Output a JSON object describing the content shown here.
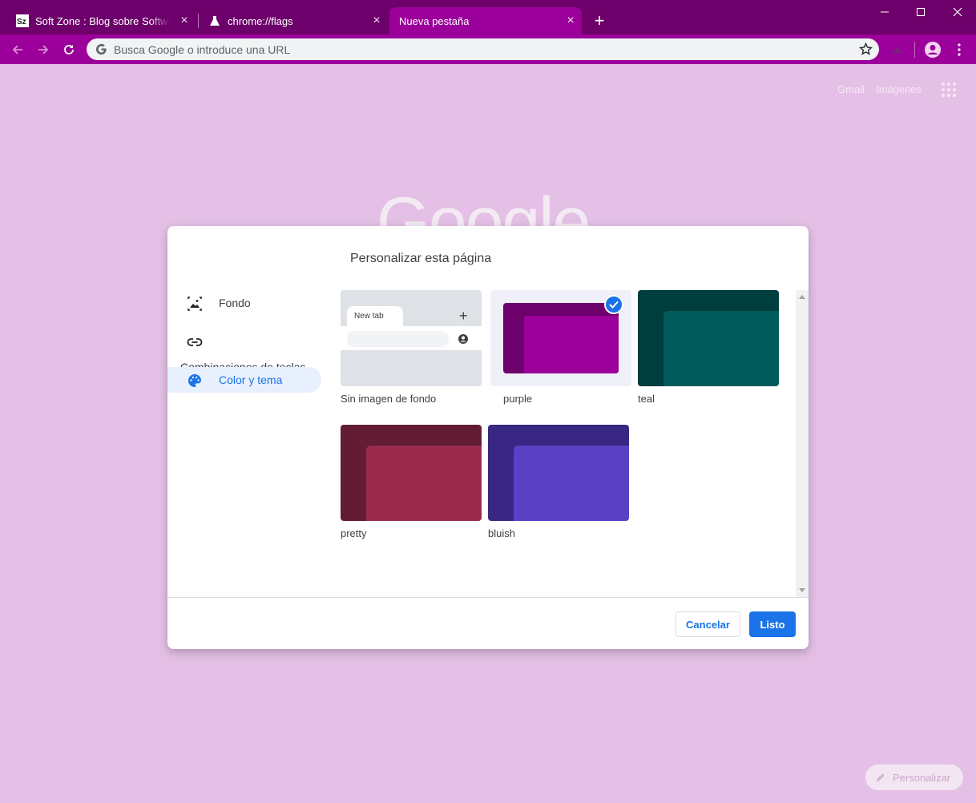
{
  "tabs": [
    {
      "title": "Soft Zone : Blog sobre Software d",
      "favicon": "softzone-icon"
    },
    {
      "title": "chrome://flags",
      "favicon": "flask-icon"
    },
    {
      "title": "Nueva pestaña",
      "favicon": "none",
      "active": true
    }
  ],
  "omnibox": {
    "placeholder": "Busca Google o introduce una URL"
  },
  "header": {
    "gmail": "Gmail",
    "images": "Imágenes"
  },
  "logo_text": "Google",
  "dialog": {
    "title": "Personalizar esta página",
    "menu": {
      "background": "Fondo",
      "shortcuts": "Combinaciones de teclas",
      "color_theme": "Color y tema"
    },
    "tiles": [
      {
        "label": "Sin imagen de fondo",
        "mock_tab": "New tab"
      },
      {
        "label": "purple",
        "back": "#6d006b",
        "front": "#9b009a",
        "selected": true
      },
      {
        "label": "teal",
        "back": "#003d3d",
        "front": "#005c5c"
      },
      {
        "label": "pretty",
        "back": "#621d34",
        "front": "#9a2b4d"
      },
      {
        "label": "bluish",
        "back": "#392883",
        "front": "#5941c6"
      }
    ],
    "cancel": "Cancelar",
    "done": "Listo"
  },
  "customize_button": "Personalizar",
  "colors": {
    "page_bg": "#e5c0e6",
    "frame": "#6d006b",
    "toolbar": "#9b009a",
    "accent": "#1a73e8"
  }
}
